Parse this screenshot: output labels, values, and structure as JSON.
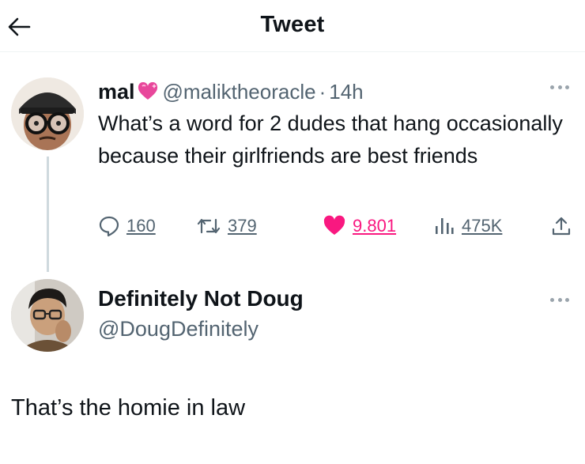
{
  "header": {
    "title": "Tweet",
    "back_icon": "arrow-left-icon"
  },
  "tweet": {
    "display_name": "mal",
    "badge_icon": "sparkling-heart-icon",
    "handle": "@maliktheoracle",
    "separator": "·",
    "time": "14h",
    "text": "What’s a word for 2 dudes that hang occasionally because their girlfriends are best friends",
    "stats": {
      "replies": "160",
      "retweets": "379",
      "likes": "9.801",
      "views": "475K"
    },
    "colors": {
      "like": "#f91880",
      "muted": "#536471",
      "text": "#0f1419"
    }
  },
  "reply": {
    "display_name": "Definitely Not Doug",
    "handle": "@DougDefinitely",
    "text": "That’s the homie in law"
  }
}
